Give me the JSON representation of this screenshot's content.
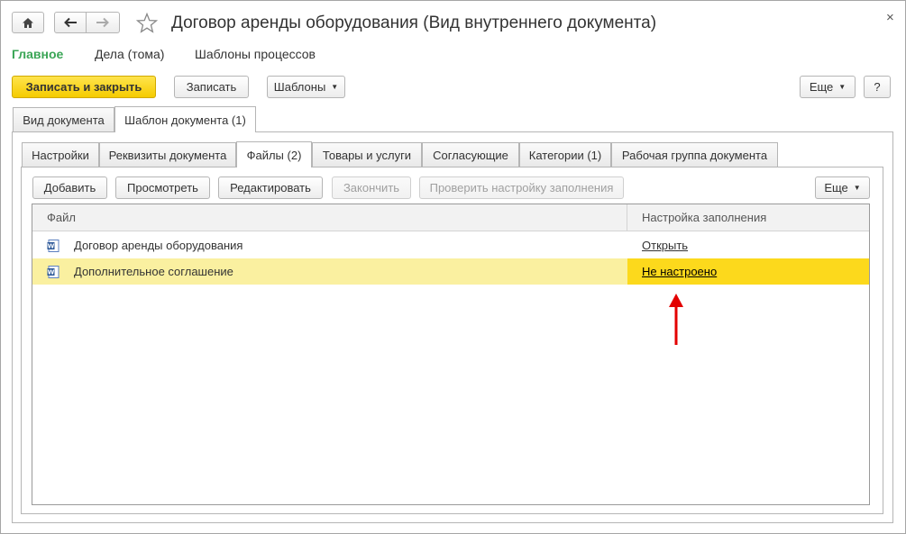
{
  "window": {
    "title": "Договор аренды оборудования (Вид внутреннего документа)",
    "close_label": "×"
  },
  "sections": [
    {
      "label": "Главное",
      "active": true
    },
    {
      "label": "Дела (тома)",
      "active": false
    },
    {
      "label": "Шаблоны процессов",
      "active": false
    }
  ],
  "toolbar": {
    "save_close": "Записать и закрыть",
    "save": "Записать",
    "templates": "Шаблоны",
    "more": "Еще",
    "help": "?"
  },
  "outer_tabs": [
    {
      "label": "Вид документа",
      "active": false
    },
    {
      "label": "Шаблон документа (1)",
      "active": true
    }
  ],
  "inner_tabs": [
    {
      "label": "Настройки",
      "active": false
    },
    {
      "label": "Реквизиты документа",
      "active": false
    },
    {
      "label": "Файлы (2)",
      "active": true
    },
    {
      "label": "Товары и услуги",
      "active": false
    },
    {
      "label": "Согласующие",
      "active": false
    },
    {
      "label": "Категории (1)",
      "active": false
    },
    {
      "label": "Рабочая группа документа",
      "active": false
    }
  ],
  "files_toolbar": {
    "add": "Добавить",
    "view": "Просмотреть",
    "edit": "Редактировать",
    "finish": "Закончить",
    "check": "Проверить настройку заполнения",
    "more": "Еще"
  },
  "table": {
    "columns": [
      "Файл",
      "Настройка заполнения"
    ],
    "rows": [
      {
        "file": "Договор аренды оборудования",
        "setting": "Открыть",
        "selected": false
      },
      {
        "file": "Дополнительное соглашение",
        "setting": "Не настроено",
        "selected": true
      }
    ]
  },
  "colors": {
    "accent_green": "#3aa556",
    "primary_yellow": "#f5cb00",
    "selection": "#faf0a0",
    "highlight": "#fcd91c",
    "arrow": "#e30000"
  },
  "icons": {
    "home": "home-icon",
    "back": "arrow-left-icon",
    "forward": "arrow-right-icon",
    "favorite": "star-icon",
    "word_doc": "word-document-icon"
  }
}
